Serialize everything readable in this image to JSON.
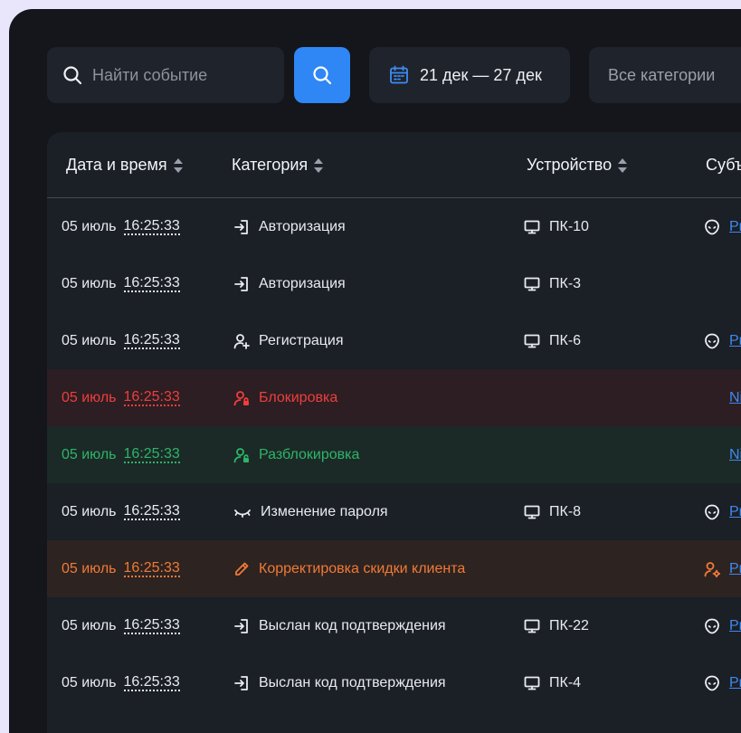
{
  "search": {
    "placeholder": "Найти событие"
  },
  "date_filter": {
    "label": "21 дек — 27 дек"
  },
  "category_filter": {
    "label": "Все категории"
  },
  "table": {
    "headers": [
      "Дата и время",
      "Категория",
      "Устройство",
      "Субъ"
    ],
    "rows": [
      {
        "date": "05 июль",
        "time": "16:25:33",
        "category": "Авторизация",
        "category_icon": "login-icon",
        "device": "ПК-10",
        "subject": "Pr",
        "subject_icon": "alien-icon",
        "status": "normal"
      },
      {
        "date": "05 июль",
        "time": "16:25:33",
        "category": "Авторизация",
        "category_icon": "login-icon",
        "device": "ПК-3",
        "subject": "",
        "subject_icon": "",
        "status": "normal"
      },
      {
        "date": "05 июль",
        "time": "16:25:33",
        "category": "Регистрация",
        "category_icon": "user-plus-icon",
        "device": "ПК-6",
        "subject": "Pr",
        "subject_icon": "alien-icon",
        "status": "normal"
      },
      {
        "date": "05 июль",
        "time": "16:25:33",
        "category": "Блокировка",
        "category_icon": "user-lock-icon",
        "device": "",
        "subject": "Ni",
        "subject_icon": "",
        "status": "error"
      },
      {
        "date": "05 июль",
        "time": "16:25:33",
        "category": "Разблокировка",
        "category_icon": "user-unlock-icon",
        "device": "",
        "subject": "Ni",
        "subject_icon": "",
        "status": "success"
      },
      {
        "date": "05 июль",
        "time": "16:25:33",
        "category": "Изменение пароля",
        "category_icon": "eye-closed-icon",
        "device": "ПК-8",
        "subject": "Pr",
        "subject_icon": "alien-icon",
        "status": "normal"
      },
      {
        "date": "05 июль",
        "time": "16:25:33",
        "category": "Корректировка скидки клиента",
        "category_icon": "pencil-icon",
        "device": "",
        "subject": "Pr",
        "subject_icon": "user-gear-icon",
        "status": "warning"
      },
      {
        "date": "05 июль",
        "time": "16:25:33",
        "category": "Выслан код подтверждения",
        "category_icon": "login-icon",
        "device": "ПК-22",
        "subject": "Pr",
        "subject_icon": "alien-icon",
        "status": "normal"
      },
      {
        "date": "05 июль",
        "time": "16:25:33",
        "category": "Выслан код подтверждения",
        "category_icon": "login-icon",
        "device": "ПК-4",
        "subject": "Pr",
        "subject_icon": "alien-icon",
        "status": "normal"
      }
    ]
  },
  "colors": {
    "accent": "#2f86f5",
    "error": "#ef3e3e",
    "success": "#2eb46a",
    "warning": "#f07a36",
    "link": "#3f89f0"
  }
}
